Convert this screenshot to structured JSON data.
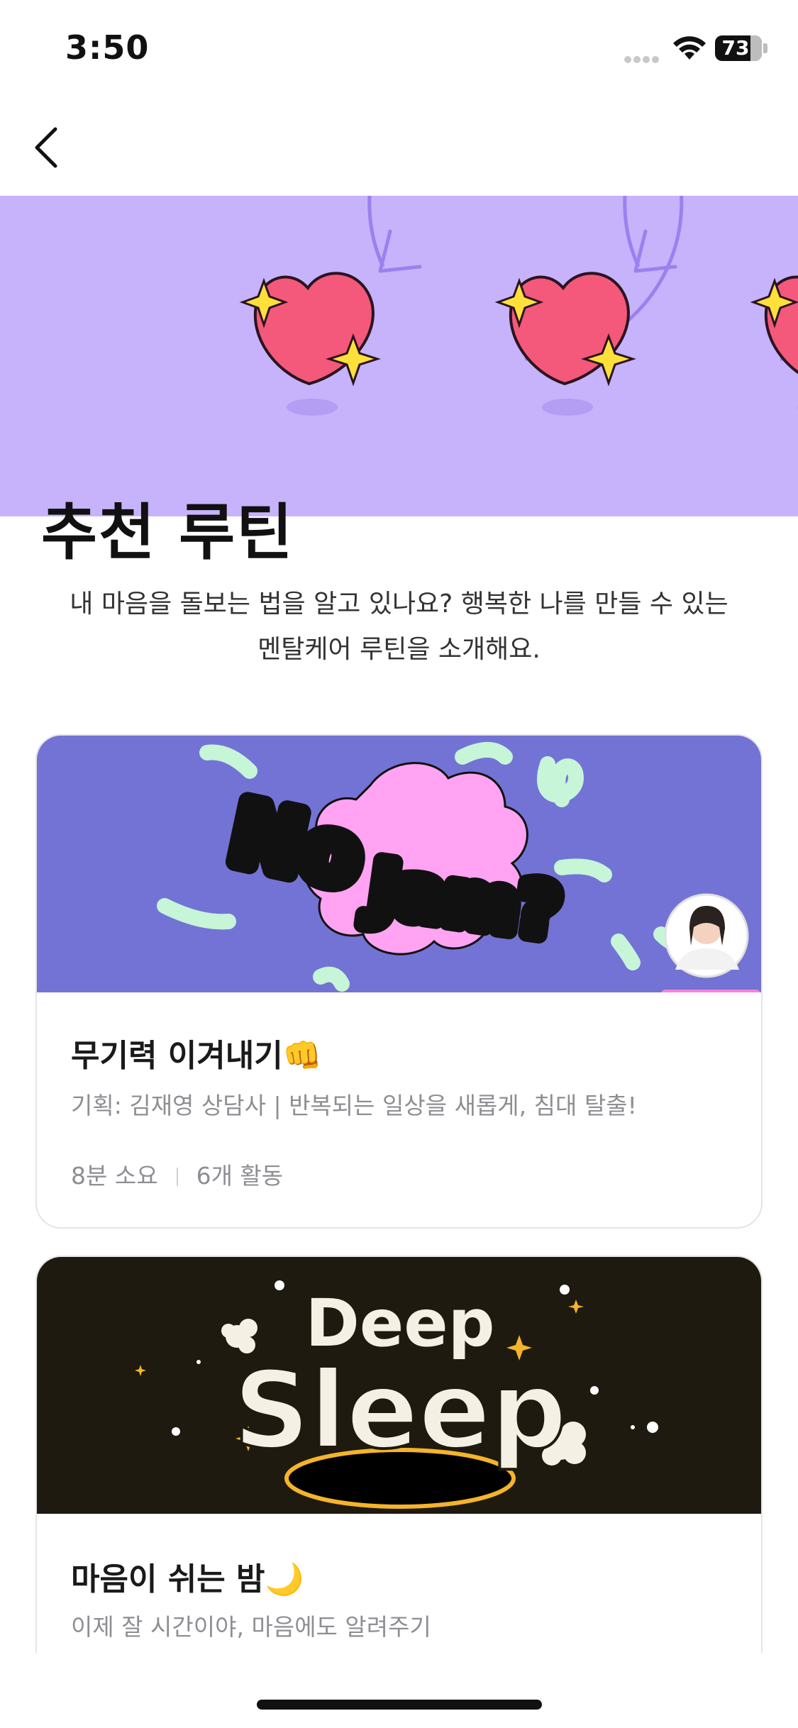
{
  "status_bar": {
    "time": "3:50",
    "battery": "73"
  },
  "page": {
    "title": "추천 루틴",
    "description_line1": "내 마음을 돌보는 법을 알고 있나요? 행복한 나를 만들 수 있는",
    "description_line2": "멘탈케어 루틴을 소개해요."
  },
  "routines": [
    {
      "image_text_1": "No",
      "image_text_2": "Jam?",
      "title": "무기력 이겨내기👊",
      "subtitle": "기획: 김재영 상담사 | 반복되는 일상을 새롭게, 침대 탈출!",
      "duration": "8분 소요",
      "activities": "6개 활동"
    },
    {
      "image_text_1": "Deep",
      "image_text_2": "Sleep",
      "title": "마음이 쉬는 밤🌙",
      "subtitle": "이제 잘 시간이야, 마음에도 알려주기"
    }
  ],
  "colors": {
    "hero_bg": "#c6b3fb",
    "card1_bg": "#7373d5",
    "card2_bg": "#1e1a10",
    "heart": "#f4587a",
    "sparkle": "#ffe03a"
  },
  "icons": [
    "back-chevron-icon",
    "wifi-icon",
    "battery-icon",
    "heart-icon",
    "sparkle-icon",
    "avatar"
  ]
}
